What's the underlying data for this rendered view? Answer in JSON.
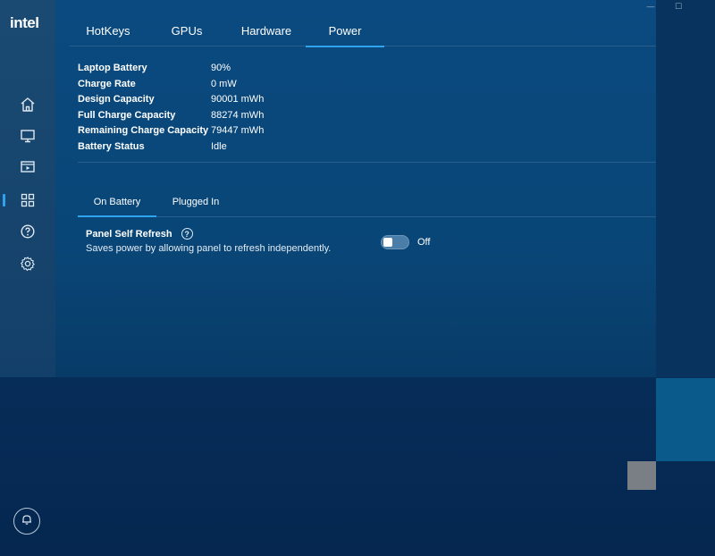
{
  "app": {
    "logo": "intel"
  },
  "window_controls": {
    "minimize": "—",
    "maximize": "☐"
  },
  "tabs": [
    {
      "label": "HotKeys"
    },
    {
      "label": "GPUs"
    },
    {
      "label": "Hardware"
    },
    {
      "label": "Power",
      "active": true
    }
  ],
  "battery_info": [
    {
      "label": "Laptop Battery",
      "value": "90%"
    },
    {
      "label": "Charge Rate",
      "value": "0 mW"
    },
    {
      "label": "Design Capacity",
      "value": "90001 mWh"
    },
    {
      "label": "Full Charge Capacity",
      "value": "88274 mWh"
    },
    {
      "label": "Remaining Charge Capacity",
      "value": "79447 mWh"
    },
    {
      "label": "Battery Status",
      "value": "Idle"
    }
  ],
  "subtabs": [
    {
      "label": "On Battery",
      "active": true
    },
    {
      "label": "Plugged In"
    }
  ],
  "setting": {
    "title": "Panel Self Refresh",
    "help": "?",
    "description": "Saves power by allowing panel to refresh independently.",
    "toggle_state": "Off"
  },
  "sidebar_icons": [
    "home-icon",
    "display-icon",
    "media-icon",
    "apps-icon",
    "help-icon",
    "settings-icon"
  ],
  "colors": {
    "accent": "#2fa3ee",
    "background": "#094677",
    "sidebar": "#174670"
  }
}
